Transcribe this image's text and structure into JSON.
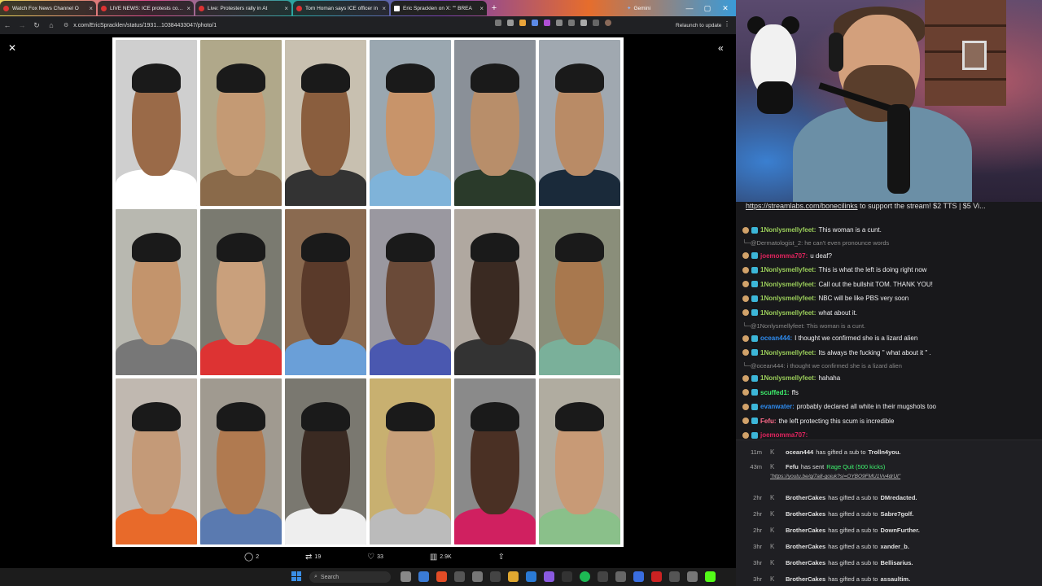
{
  "browser": {
    "tabs": [
      {
        "title": "Watch Fox News Channel O"
      },
      {
        "title": "LIVE NEWS: ICE protests contin"
      },
      {
        "title": "Live: Protesters rally in At"
      },
      {
        "title": "Tom Homan says ICE officer in"
      },
      {
        "title": "Eric Spracklen on X: \"\" BREA"
      }
    ],
    "gemini_tab": "Gemini",
    "url": "x.com/EricSpracklen/status/1931...10384433047/photo/1",
    "relaunch_label": "Relaunch to update",
    "colors": {
      "accent": "#3a8ee6",
      "chat_bg": "#18181b"
    }
  },
  "post": {
    "replies": "2",
    "reposts": "19",
    "likes": "33",
    "views": "2.9K"
  },
  "taskbar": {
    "search_placeholder": "Search"
  },
  "chat": {
    "pinned_link": "https://streamlabs.com/bonecilinks",
    "pinned_text": " to support the stream! $2 TTS | $5 Vi...",
    "messages": [
      {
        "kind": "msg",
        "user": "1Nonlysmellyfeet:",
        "color": "#9acd5a",
        "text": "This woman is a cunt."
      },
      {
        "kind": "reply",
        "text": "@Dermatologist_2: he can't even pronounce words"
      },
      {
        "kind": "msg",
        "user": "joemomma707:",
        "color": "#e0245e",
        "text": "u deaf?"
      },
      {
        "kind": "msg",
        "user": "1Nonlysmellyfeet:",
        "color": "#9acd5a",
        "text": "This is what the left is doing right now"
      },
      {
        "kind": "msg",
        "user": "1Nonlysmellyfeet:",
        "color": "#9acd5a",
        "text": "Call out the bullshit TOM. THANK YOU!"
      },
      {
        "kind": "msg",
        "user": "1Nonlysmellyfeet:",
        "color": "#9acd5a",
        "text": "NBC will be like PBS very soon"
      },
      {
        "kind": "msg",
        "user": "1Nonlysmellyfeet:",
        "color": "#9acd5a",
        "text": "what about it."
      },
      {
        "kind": "reply",
        "text": "@1Nonlysmellyfeet: This woman is a cunt."
      },
      {
        "kind": "msg",
        "user": "ocean444:",
        "color": "#2e8cf0",
        "text": "I thought we confirmed she is a lizard alien"
      },
      {
        "kind": "msg",
        "user": "1Nonlysmellyfeet:",
        "color": "#9acd5a",
        "text": "Its always the fucking \" what about it \" ."
      },
      {
        "kind": "reply",
        "text": "@ocean444: i thought we confirmed she is a lizard alien"
      },
      {
        "kind": "msg",
        "user": "1Nonlysmellyfeet:",
        "color": "#9acd5a",
        "text": "hahaha"
      },
      {
        "kind": "msg",
        "user": "scuffed1:",
        "color": "#3ef26e",
        "text": "ffs"
      },
      {
        "kind": "msg",
        "user": "evanwater:",
        "color": "#2e8cf0",
        "text": "probably declared all white in their mugshots too"
      },
      {
        "kind": "msg",
        "user": "Fefu:",
        "color": "#ff6b8a",
        "text": "the left protecting this scum is incredible"
      },
      {
        "kind": "msg",
        "user": "joemomma707:",
        "color": "#e0245e",
        "text": ""
      }
    ],
    "gifts": [
      {
        "time": "11m",
        "user": "ocean444",
        "action": "has gifted a sub to",
        "target": "Trolln4you."
      },
      {
        "time": "43m",
        "user": "Fefu",
        "action": "has sent",
        "target": "Rage Quit (500 kicks)",
        "link": "\"https://youtu.be/qi7a8-goiuk?si=OYBO9FMU1Vv4drUt\""
      },
      {
        "time": "2hr",
        "user": "BrotherCakes",
        "action": "has gifted a sub to",
        "target": "DMredacted."
      },
      {
        "time": "2hr",
        "user": "BrotherCakes",
        "action": "has gifted a sub to",
        "target": "Sabre7golf."
      },
      {
        "time": "2hr",
        "user": "BrotherCakes",
        "action": "has gifted a sub to",
        "target": "DownFurther."
      },
      {
        "time": "3hr",
        "user": "BrotherCakes",
        "action": "has gifted a sub to",
        "target": "xander_b."
      },
      {
        "time": "3hr",
        "user": "BrotherCakes",
        "action": "has gifted a sub to",
        "target": "Bellisarius."
      },
      {
        "time": "3hr",
        "user": "BrotherCakes",
        "action": "has gifted a sub to",
        "target": "assaultim."
      }
    ]
  }
}
